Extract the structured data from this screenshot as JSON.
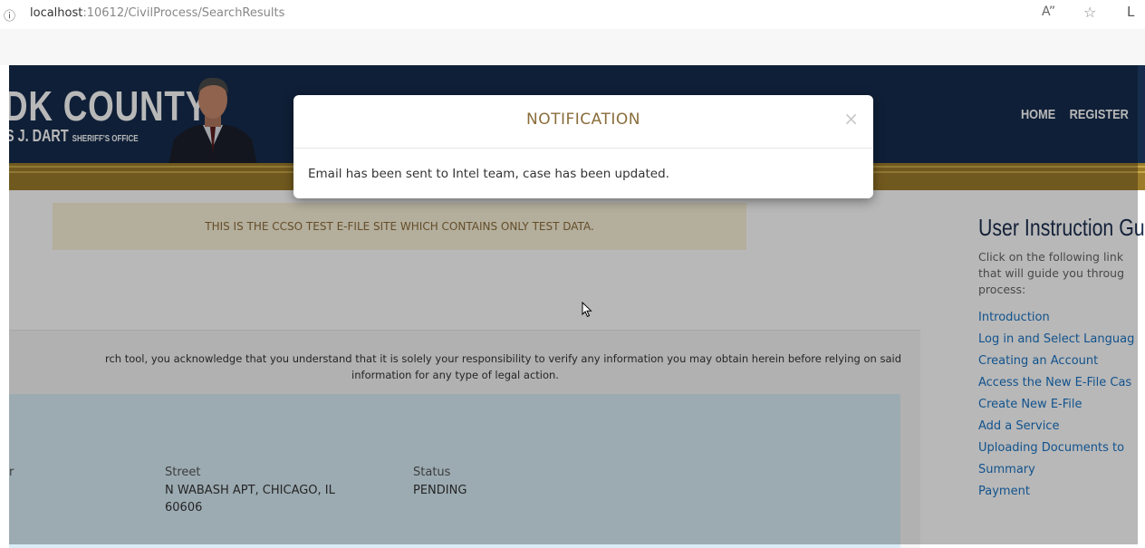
{
  "browser": {
    "url_host": "localhost",
    "url_path": ":10612/CivilProcess/SearchResults",
    "info_icon": "info-icon",
    "read_aloud": "A”",
    "favorite": "☆",
    "extra": "L"
  },
  "header": {
    "logo_line1": "DK COUNTY",
    "logo_line2": "S J. DART",
    "logo_line2_small": "SHERIFF'S OFFICE",
    "nav": [
      "HOME",
      "REGISTER"
    ]
  },
  "notice": "THIS IS THE CCSO TEST E-FILE SITE WHICH CONTAINS ONLY TEST DATA.",
  "disclaimer": {
    "line1": "rch tool, you acknowledge that you understand that it is solely your responsibility to verify any information you may obtain herein before relying on said",
    "line2": "information for any type of legal action."
  },
  "result": {
    "col0_label": "r",
    "street_label": "Street",
    "street_value": "N WABASH APT, CHICAGO, IL 60606",
    "status_label": "Status",
    "status_value": "PENDING"
  },
  "sidebar": {
    "title": "User Instruction Gu",
    "desc": [
      "Click on the following link",
      "that will guide you throug",
      "process:"
    ],
    "links": [
      "Introduction",
      "Log in and Select Languag",
      "Creating an Account",
      "Access the New E-File Cas",
      "Create New E-File",
      "Add a Service",
      "Uploading Documents to",
      "Summary",
      "Payment"
    ]
  },
  "modal": {
    "title": "NOTIFICATION",
    "close": "×",
    "message": "Email has been sent to Intel team, case has been updated."
  }
}
